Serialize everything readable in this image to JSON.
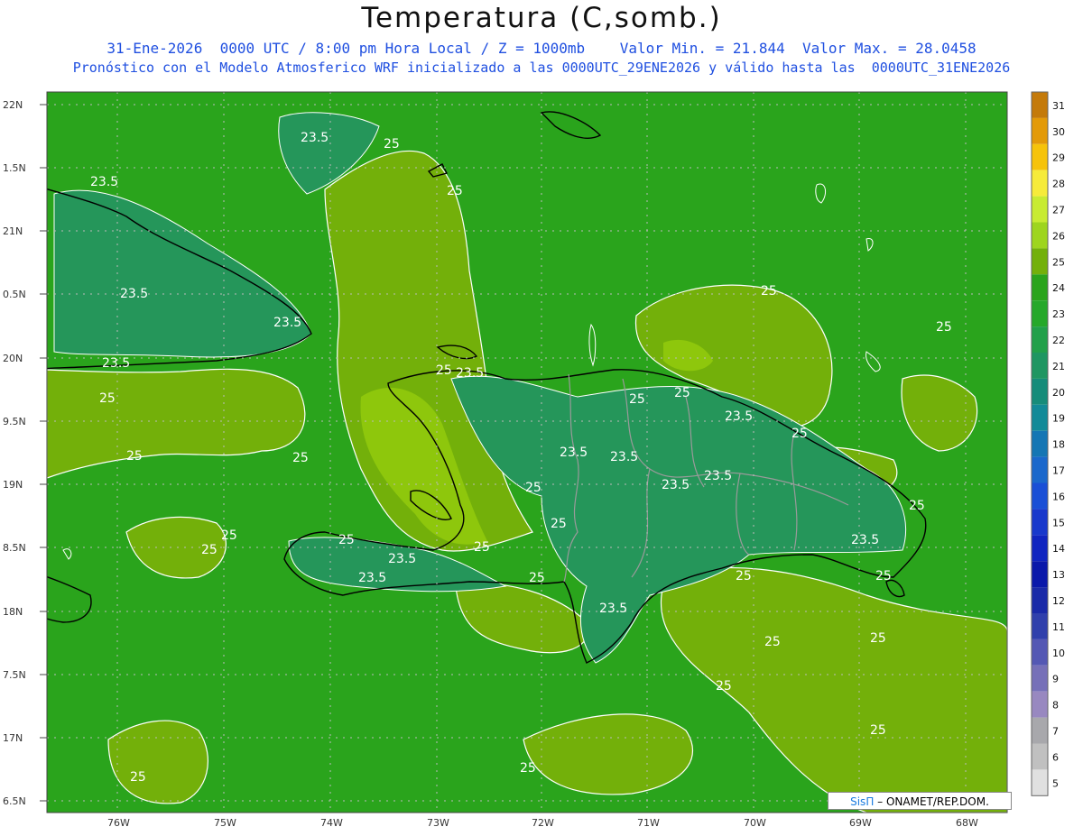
{
  "title": "Temperatura (C,somb.)",
  "subtitle1": "31-Ene-2026  0000 UTC / 8:00 pm Hora Local / Z = 1000mb    Valor Min. = 21.844  Valor Max. = 28.0458",
  "subtitle2": "Pronóstico con el Modelo Atmosferico WRF inicializado a las 0000UTC_29ENE2026 y válido hasta las  0000UTC_31ENE2026",
  "lat_labels": [
    "22N",
    "1.5N",
    "21N",
    "0.5N",
    "20N",
    "9.5N",
    "19N",
    "8.5N",
    "18N",
    "7.5N",
    "17N",
    "6.5N"
  ],
  "lon_labels": [
    "76W",
    "75W",
    "74W",
    "73W",
    "72W",
    "71W",
    "70W",
    "69W",
    "68W"
  ],
  "contour_labels": [
    "23.5",
    "25"
  ],
  "colorbar": {
    "levels": [
      "31",
      "30",
      "29",
      "28",
      "27",
      "26",
      "25",
      "24",
      "23",
      "22",
      "21",
      "20",
      "19",
      "18",
      "17",
      "16",
      "15",
      "14",
      "13",
      "12",
      "11",
      "10",
      "9",
      "8",
      "7",
      "6",
      "5"
    ],
    "colors": [
      "#c47a0a",
      "#e39a08",
      "#f6c30a",
      "#f6eb3a",
      "#c8eb32",
      "#9ed51e",
      "#73b00a",
      "#2aa41c",
      "#26a82a",
      "#22a04a",
      "#1f9662",
      "#168c7a",
      "#128a98",
      "#1576b4",
      "#1b68cc",
      "#1a4fd6",
      "#1838cc",
      "#1024c0",
      "#0a18aa",
      "#1a2aa8",
      "#3040ac",
      "#5458b4",
      "#7670b8",
      "#9888c0",
      "#a8a8ac",
      "#c0c0c0",
      "#e0e0e0"
    ]
  },
  "credit": {
    "brand": "SisΠ",
    "text": "– ONAMET/REP.DOM."
  },
  "colors": {
    "sea": "#2aa41c",
    "land_warm": "#73b00a",
    "land_hot": "#8ec70c",
    "cool": "#25965a"
  }
}
